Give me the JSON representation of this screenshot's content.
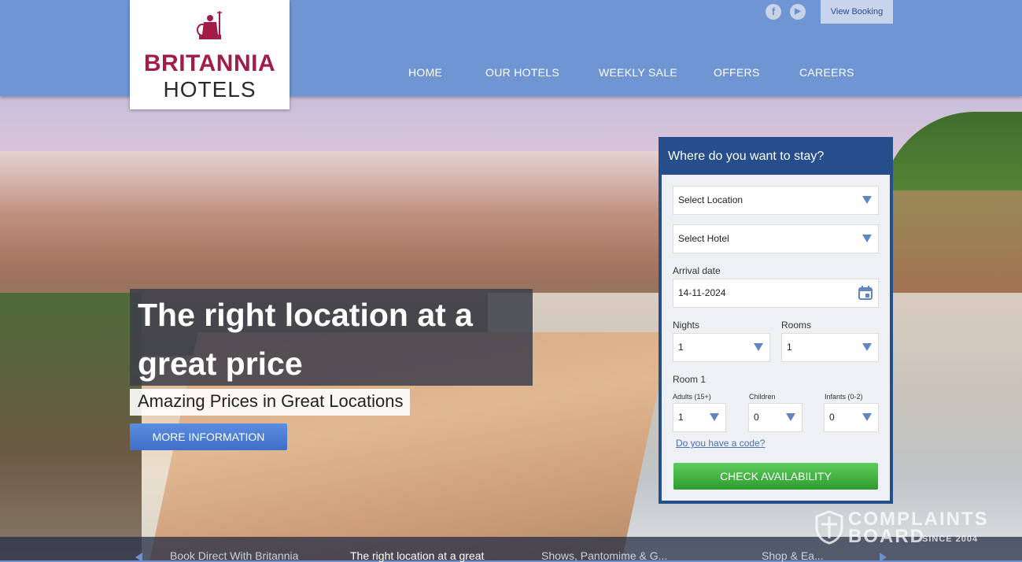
{
  "brand": {
    "line1": "BRITANNIA",
    "line2": "HOTELS"
  },
  "header": {
    "social": [
      {
        "icon": "facebook-icon",
        "glyph": "f"
      },
      {
        "icon": "youtube-icon",
        "glyph": "▶"
      }
    ],
    "view_booking": "View Booking",
    "nav": [
      "HOME",
      "OUR HOTELS",
      "WEEKLY SALE",
      "OFFERS",
      "CAREERS"
    ]
  },
  "hero": {
    "headline": "The right location at a great price",
    "subline": "Amazing Prices in Great Locations",
    "more_button": "MORE INFORMATION"
  },
  "booking": {
    "title": "Where do you want to stay?",
    "location_select": "Select Location",
    "hotel_select": "Select Hotel",
    "arrival_label": "Arrival date",
    "arrival_value": "14-11-2024",
    "nights_label": "Nights",
    "nights_value": "1",
    "rooms_label": "Rooms",
    "rooms_value": "1",
    "room_label": "Room 1",
    "adults_label": "Adults (15+)",
    "adults_value": "1",
    "children_label": "Children",
    "children_value": "0",
    "infants_label": "Infants (0-2)",
    "infants_value": "0",
    "code_link": "Do you have a code?",
    "check_button": "CHECK AVAILABILITY"
  },
  "ticker": {
    "items": [
      "Book Direct With Britannia",
      "The right location at a great",
      "Shows, Pantomime & G...",
      "Shop & Ea..."
    ]
  },
  "watermark": {
    "line1": "COMPLAINTS",
    "line2": "BOARD",
    "since": "SINCE 2004"
  },
  "colors": {
    "header": "#7095d3",
    "brand_red": "#a11c46",
    "panel": "#264e8c",
    "check_green": "#3aa83a",
    "button_blue": "#4a7dd6"
  }
}
